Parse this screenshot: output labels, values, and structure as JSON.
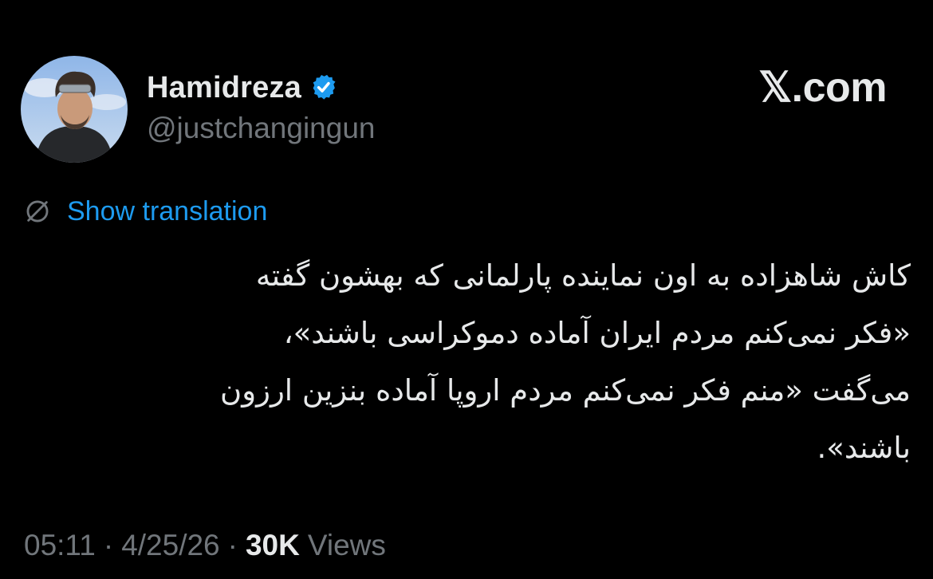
{
  "brand": "𝕏.com",
  "author": {
    "display_name": "Hamidreza",
    "handle": "@justchangingun",
    "verified": true,
    "avatar_icon": "avatar-photo",
    "verified_icon": "verified-badge-icon"
  },
  "translation": {
    "icon": "globe-icon",
    "label": "Show translation"
  },
  "tweet": {
    "lines": [
      "کاش شاهزاده به اون نماینده پارلمانی که بهشون گفته",
      "«فکر نمی‌کنم مردم ایران آماده دموکراسی باشند»،",
      "می‌گفت «منم فکر نمی‌کنم مردم اروپا آماده بنزین ارزون",
      "باشند»."
    ]
  },
  "meta": {
    "time": "05:11",
    "date": "4/25/26",
    "views_count": "30K",
    "views_label": "Views",
    "separator": "·"
  },
  "colors": {
    "background": "#000000",
    "text": "#e7e9ea",
    "secondary": "#71767b",
    "link": "#1d9bf0",
    "verified": "#1d9bf0"
  }
}
